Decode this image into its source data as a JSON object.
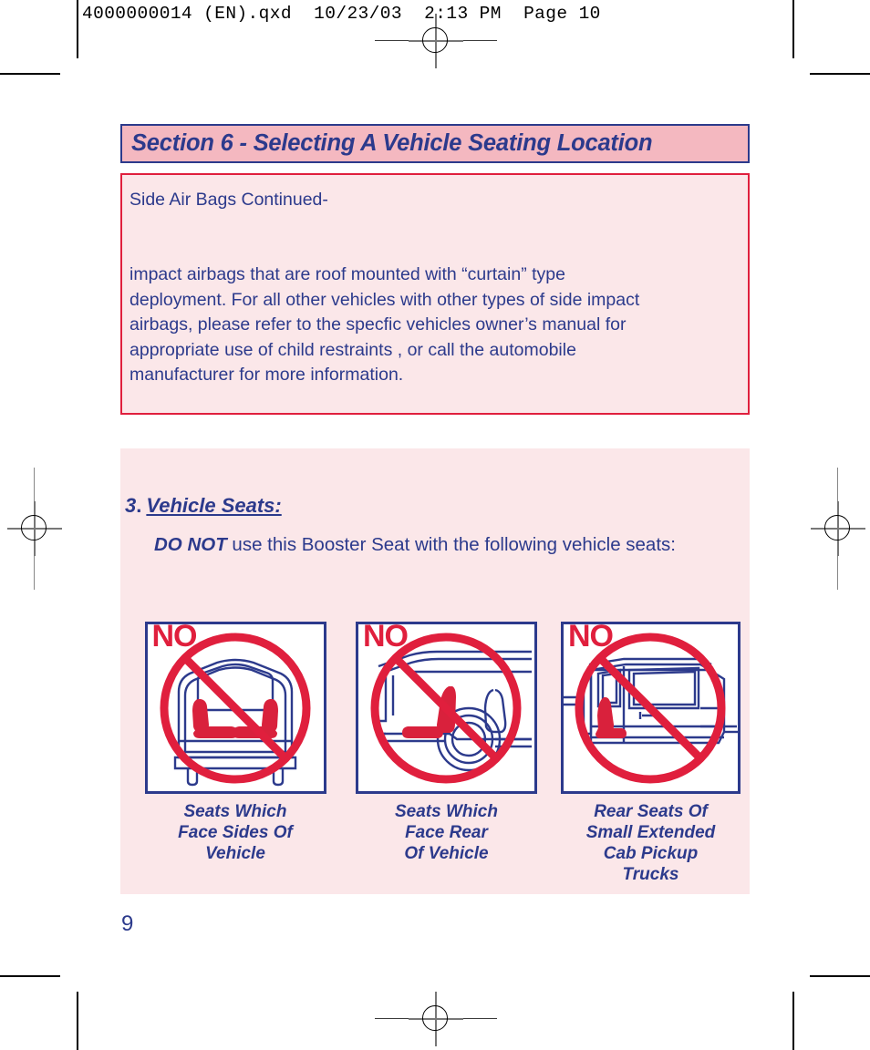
{
  "print_header": "4000000014 (EN).qxd  10/23/03  2:13 PM  Page 10",
  "section": {
    "title": "Section 6 - Selecting A Vehicle Seating Location"
  },
  "note": {
    "lead": "Side Air Bags Continued-",
    "lines": [
      "impact airbags that are roof mounted with “curtain” type",
      "deployment. For  all other vehicles with other types of side impact",
      "airbags, please refer to the specfic vehicles owner’s manual for",
      "appropriate use of  child restraints , or call the automobile",
      "manufacturer for more information."
    ]
  },
  "step": {
    "number": "3",
    "dot": ".",
    "label": "Vehicle Seats:",
    "warning_prefix": "DO NOT",
    "warning_rest": " use this Booster Seat with the following vehicle seats:"
  },
  "figures": [
    {
      "no_label": "NO",
      "icon": "side-facing-seats-prohibited-icon",
      "caption": [
        "Seats Which",
        "Face Sides Of",
        "Vehicle"
      ]
    },
    {
      "no_label": "NO",
      "icon": "rear-facing-seat-prohibited-icon",
      "caption": [
        "Seats Which",
        "Face Rear",
        "Of Vehicle"
      ]
    },
    {
      "no_label": "NO",
      "icon": "extended-cab-pickup-rear-seat-prohibited-icon",
      "caption": [
        "Rear Seats Of",
        "Small Extended",
        "Cab Pickup",
        "Trucks"
      ]
    }
  ],
  "page_number": "9",
  "colors": {
    "brand_blue": "#2c3a8c",
    "alert_red": "#e01f3d",
    "title_pink": "#f4b8c0",
    "panel_pink": "#fbe7e9"
  }
}
